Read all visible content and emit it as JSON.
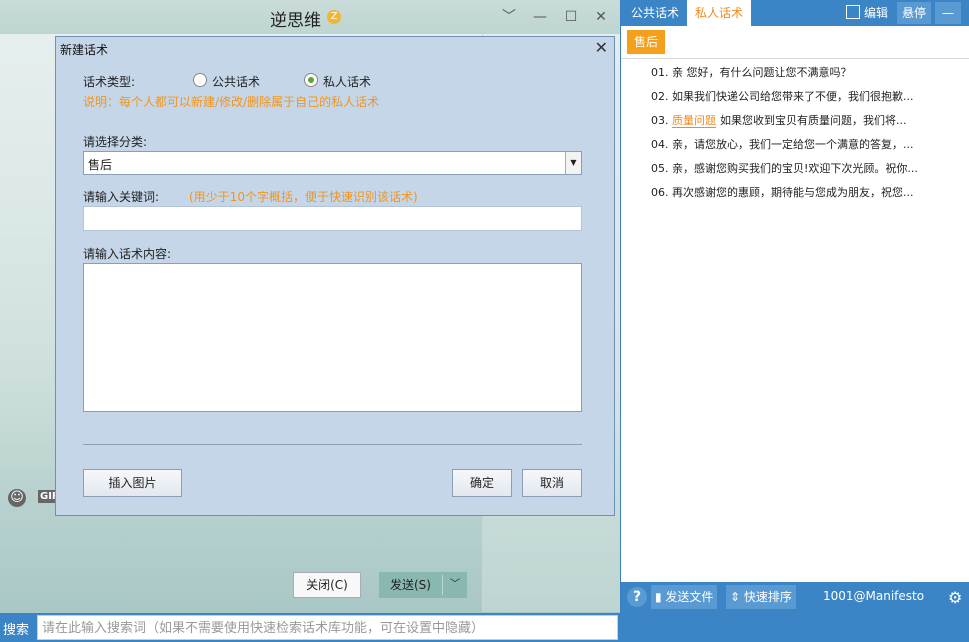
{
  "chat": {
    "title": "逆思维",
    "title_badge": "Z",
    "close_label": "关闭(C)",
    "send_label": "发送(S)",
    "gif_label": "GIF"
  },
  "dialog": {
    "title": "新建话术",
    "type_label": "话术类型:",
    "type_options": [
      "公共话术",
      "私人话术"
    ],
    "type_selected": "私人话术",
    "type_note": "说明：每个人都可以新建/修改/删除属于自己的私人话术",
    "category_label": "请选择分类:",
    "category_value": "售后",
    "keyword_label": "请输入关键词:",
    "keyword_hint": "(用少于10个字概括，便于快速识别该话术)",
    "keyword_value": "",
    "content_label": "请输入话术内容:",
    "content_value": "",
    "insert_image_label": "插入图片",
    "ok_label": "确定",
    "cancel_label": "取消"
  },
  "panel": {
    "tabs": [
      "公共话术",
      "私人话术"
    ],
    "active_tab": "私人话术",
    "edit_label": "编辑",
    "pin_label": "悬停",
    "min_label": "—",
    "category_chip": "售后",
    "items": [
      {
        "num": "01.",
        "tag": "",
        "text": "亲 您好，有什么问题让您不满意吗？"
      },
      {
        "num": "02.",
        "tag": "",
        "text": "如果我们快递公司给您带来了不便，我们很抱歉..."
      },
      {
        "num": "03.",
        "tag": "质量问题",
        "text": "如果您收到宝贝有质量问题，我们将..."
      },
      {
        "num": "04.",
        "tag": "",
        "text": "亲，请您放心，我们一定给您一个满意的答复，..."
      },
      {
        "num": "05.",
        "tag": "",
        "text": "亲，感谢您购买我们的宝贝!欢迎下次光顾。祝你..."
      },
      {
        "num": "06.",
        "tag": "",
        "text": "再次感谢您的惠顾，期待能与您成为朋友，祝您..."
      }
    ],
    "send_file_label": "发送文件",
    "sort_label": "快速排序",
    "user_id": "1001@Manifesto"
  },
  "search": {
    "label": "搜索",
    "placeholder": "请在此输入搜索词（如果不需要使用快速检索话术库功能，可在设置中隐藏）"
  }
}
